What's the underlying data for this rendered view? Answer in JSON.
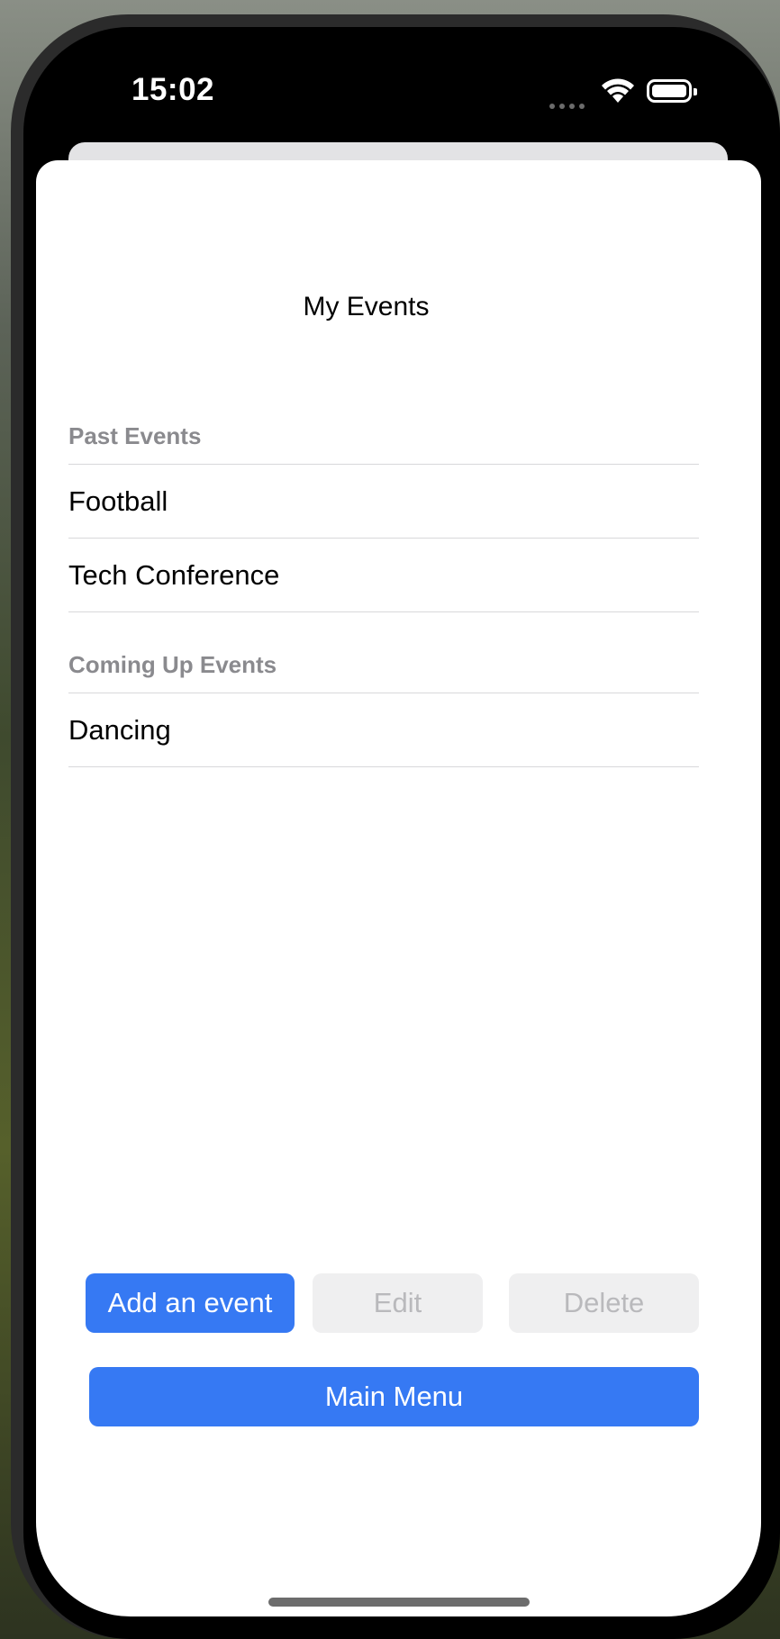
{
  "status_bar": {
    "time": "15:02"
  },
  "screen": {
    "title": "My Events",
    "sections": [
      {
        "header": "Past Events",
        "items": [
          "Football",
          "Tech Conference"
        ]
      },
      {
        "header": "Coming Up Events",
        "items": [
          "Dancing"
        ]
      }
    ],
    "actions": {
      "add_label": "Add an event",
      "edit_label": "Edit",
      "delete_label": "Delete",
      "main_menu_label": "Main Menu"
    }
  },
  "colors": {
    "accent": "#3679f3",
    "disabled_bg": "#efeff0",
    "disabled_text": "#b9b9bc",
    "section_header": "#8a8a8e"
  }
}
